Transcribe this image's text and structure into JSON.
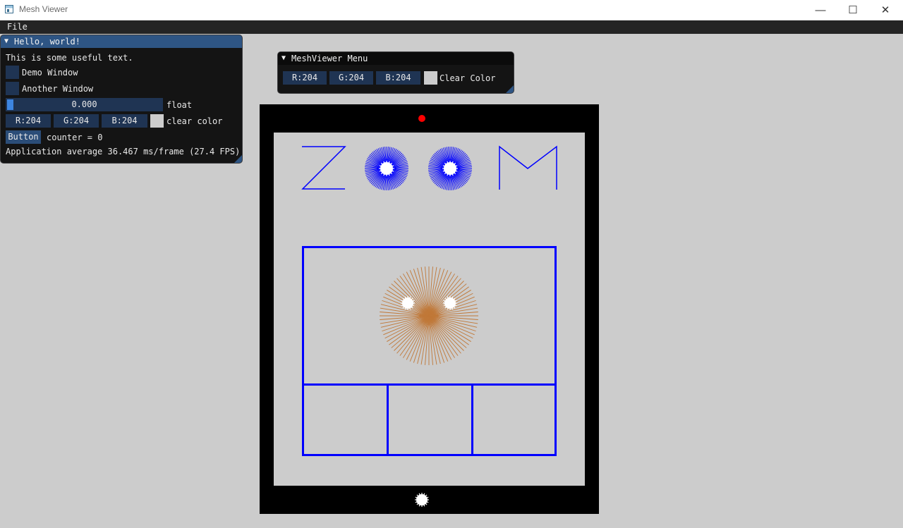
{
  "window": {
    "title": "Mesh Viewer"
  },
  "menu": {
    "file_label": "File"
  },
  "hello_window": {
    "title": "Hello, world!",
    "text": "This is some useful text.",
    "demo_checkbox": "Demo Window",
    "another_checkbox": "Another Window",
    "slider_value": "0.000",
    "slider_fraction": 0.0,
    "slider_label": "float",
    "color": {
      "r": "R:204",
      "g": "G:204",
      "b": "B:204",
      "label": "clear color",
      "swatch": "#cccccc"
    },
    "button_label": "Button",
    "counter_text": "counter = 0",
    "fps_text": "Application average 36.467 ms/frame (27.4 FPS)"
  },
  "meshviewer_window": {
    "title": "MeshViewer Menu",
    "color": {
      "r": "R:204",
      "g": "G:204",
      "b": "B:204",
      "label": "Clear Color",
      "swatch": "#cccccc"
    }
  },
  "scene": {
    "colors": {
      "background": "#cccccc",
      "device_frame": "#000000",
      "accent_blue": "#0000ff",
      "sun_brown": "#c07838",
      "record_red": "#ff0000",
      "white": "#ffffff"
    },
    "icons": [
      "zoom-z-glyph",
      "zoom-o-glyph",
      "zoom-m-glyph",
      "sunburst-face",
      "record-dot-icon",
      "home-button-icon"
    ]
  }
}
